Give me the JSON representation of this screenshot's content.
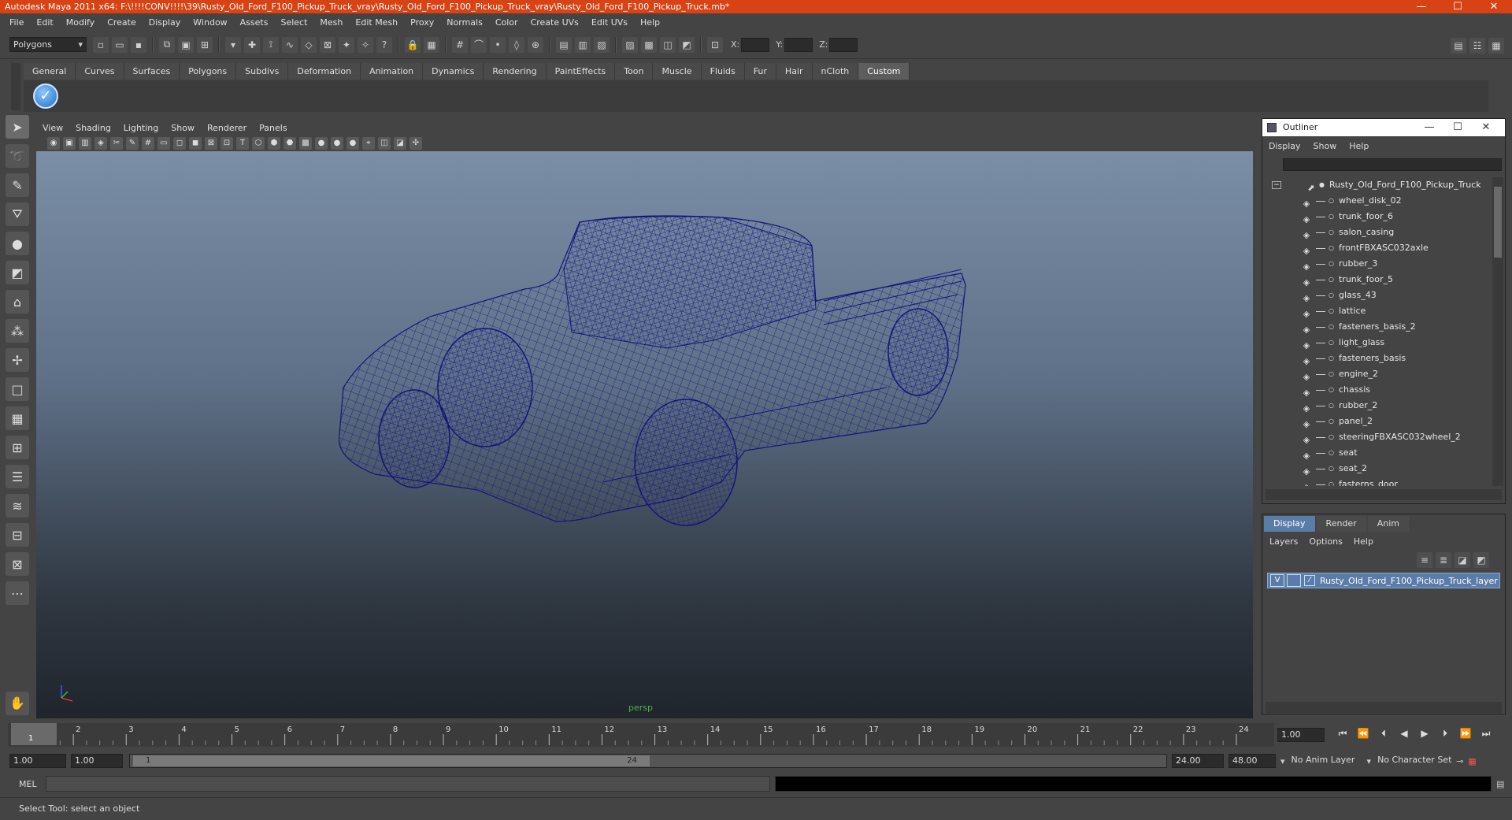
{
  "window": {
    "title": "Autodesk Maya 2011 x64: F:\\!!!!CONV!!!!\\39\\Rusty_Old_Ford_F100_Pickup_Truck_vray\\Rusty_Old_Ford_F100_Pickup_Truck_vray\\Rusty_Old_Ford_F100_Pickup_Truck.mb*",
    "accent": "#d84315",
    "controls": [
      "—",
      "☐",
      "✕"
    ]
  },
  "menubar": [
    "File",
    "Edit",
    "Modify",
    "Create",
    "Display",
    "Window",
    "Assets",
    "Select",
    "Mesh",
    "Edit Mesh",
    "Proxy",
    "Normals",
    "Color",
    "Create UVs",
    "Edit UVs",
    "Help"
  ],
  "statusline": {
    "mode": "Polygons",
    "x_label": "X:",
    "y_label": "Y:",
    "z_label": "Z:"
  },
  "shelf": {
    "tabs": [
      "General",
      "Curves",
      "Surfaces",
      "Polygons",
      "Subdivs",
      "Deformation",
      "Animation",
      "Dynamics",
      "Rendering",
      "PaintEffects",
      "Toon",
      "Muscle",
      "Fluids",
      "Fur",
      "Hair",
      "nCloth",
      "Custom"
    ],
    "active_tab": "Custom"
  },
  "viewport": {
    "menu": [
      "View",
      "Shading",
      "Lighting",
      "Show",
      "Renderer",
      "Panels"
    ],
    "camera_label": "persp",
    "wireframe_color": "#14147a"
  },
  "outliner": {
    "title": "Outliner",
    "menu": [
      "Display",
      "Show",
      "Help"
    ],
    "root": "Rusty_Old_Ford_F100_Pickup_Truck",
    "items": [
      "wheel_disk_02",
      "trunk_foor_6",
      "salon_casing",
      "frontFBXASC032axle",
      "rubber_3",
      "trunk_foor_5",
      "glass_43",
      "lattice",
      "fasteners_basis_2",
      "light_glass",
      "fasteners_basis",
      "engine_2",
      "chassis",
      "rubber_2",
      "panel_2",
      "steeringFBXASC032wheel_2",
      "seat",
      "seat_2",
      "fasterns_door"
    ]
  },
  "layer_editor": {
    "tabs": [
      "Display",
      "Render",
      "Anim"
    ],
    "active_tab": "Display",
    "menu": [
      "Layers",
      "Options",
      "Help"
    ],
    "layer_name": "Rusty_Old_Ford_F100_Pickup_Truck_layer",
    "visible_flag": "V"
  },
  "timeline": {
    "ticks": [
      "1",
      "2",
      "3",
      "4",
      "5",
      "6",
      "7",
      "8",
      "9",
      "10",
      "11",
      "12",
      "13",
      "14",
      "15",
      "16",
      "17",
      "18",
      "19",
      "20",
      "21",
      "22",
      "23",
      "24"
    ],
    "current_frame": "1",
    "current_time_field": "1.00",
    "start": 1,
    "end": 24
  },
  "range": {
    "start_time": "1.00",
    "playback_start": "1.00",
    "slider_start": "1",
    "slider_end": "24",
    "playback_end": "24.00",
    "end_time": "48.00",
    "anim_layer": "No Anim Layer",
    "character_set": "No Character Set"
  },
  "command": {
    "label": "MEL"
  },
  "helpline": "Select Tool: select an object"
}
